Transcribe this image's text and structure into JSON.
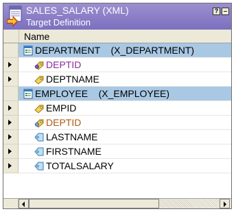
{
  "window": {
    "title": "SALES_SALARY (XML)",
    "subtitle": "Target Definition",
    "help_button": "?",
    "minimize_button": "–",
    "icon": "target-definition-icon"
  },
  "table": {
    "column_header": "Name",
    "rows": [
      {
        "label": "DEPARTMENT    (X_DEPARTMENT)",
        "icon": "group-icon",
        "selected": true,
        "arrow": false,
        "color": "#000000"
      },
      {
        "label": "DEPTID",
        "icon": "primary-key-icon",
        "selected": false,
        "arrow": true,
        "color": "#8a2a9a"
      },
      {
        "label": "DEPTNAME",
        "icon": "element-key-icon",
        "selected": false,
        "arrow": true,
        "color": "#000000"
      },
      {
        "label": "EMPLOYEE    (X_EMPLOYEE)",
        "icon": "group-icon",
        "selected": true,
        "arrow": false,
        "color": "#000000"
      },
      {
        "label": "EMPID",
        "icon": "element-key-icon",
        "selected": false,
        "arrow": true,
        "color": "#000000"
      },
      {
        "label": "DEPTID",
        "icon": "foreign-key-icon",
        "selected": false,
        "arrow": true,
        "color": "#b05a10"
      },
      {
        "label": "LASTNAME",
        "icon": "element-tag-icon",
        "selected": false,
        "arrow": true,
        "color": "#000000"
      },
      {
        "label": "FIRSTNAME",
        "icon": "element-tag-icon",
        "selected": false,
        "arrow": true,
        "color": "#000000"
      },
      {
        "label": "TOTALSALARY",
        "icon": "element-tag-icon",
        "selected": false,
        "arrow": true,
        "color": "#000000"
      }
    ]
  },
  "colors": {
    "title_bar": "#8b7fc7",
    "selection": "#a9c8e4",
    "gutter": "#ece9d8"
  }
}
